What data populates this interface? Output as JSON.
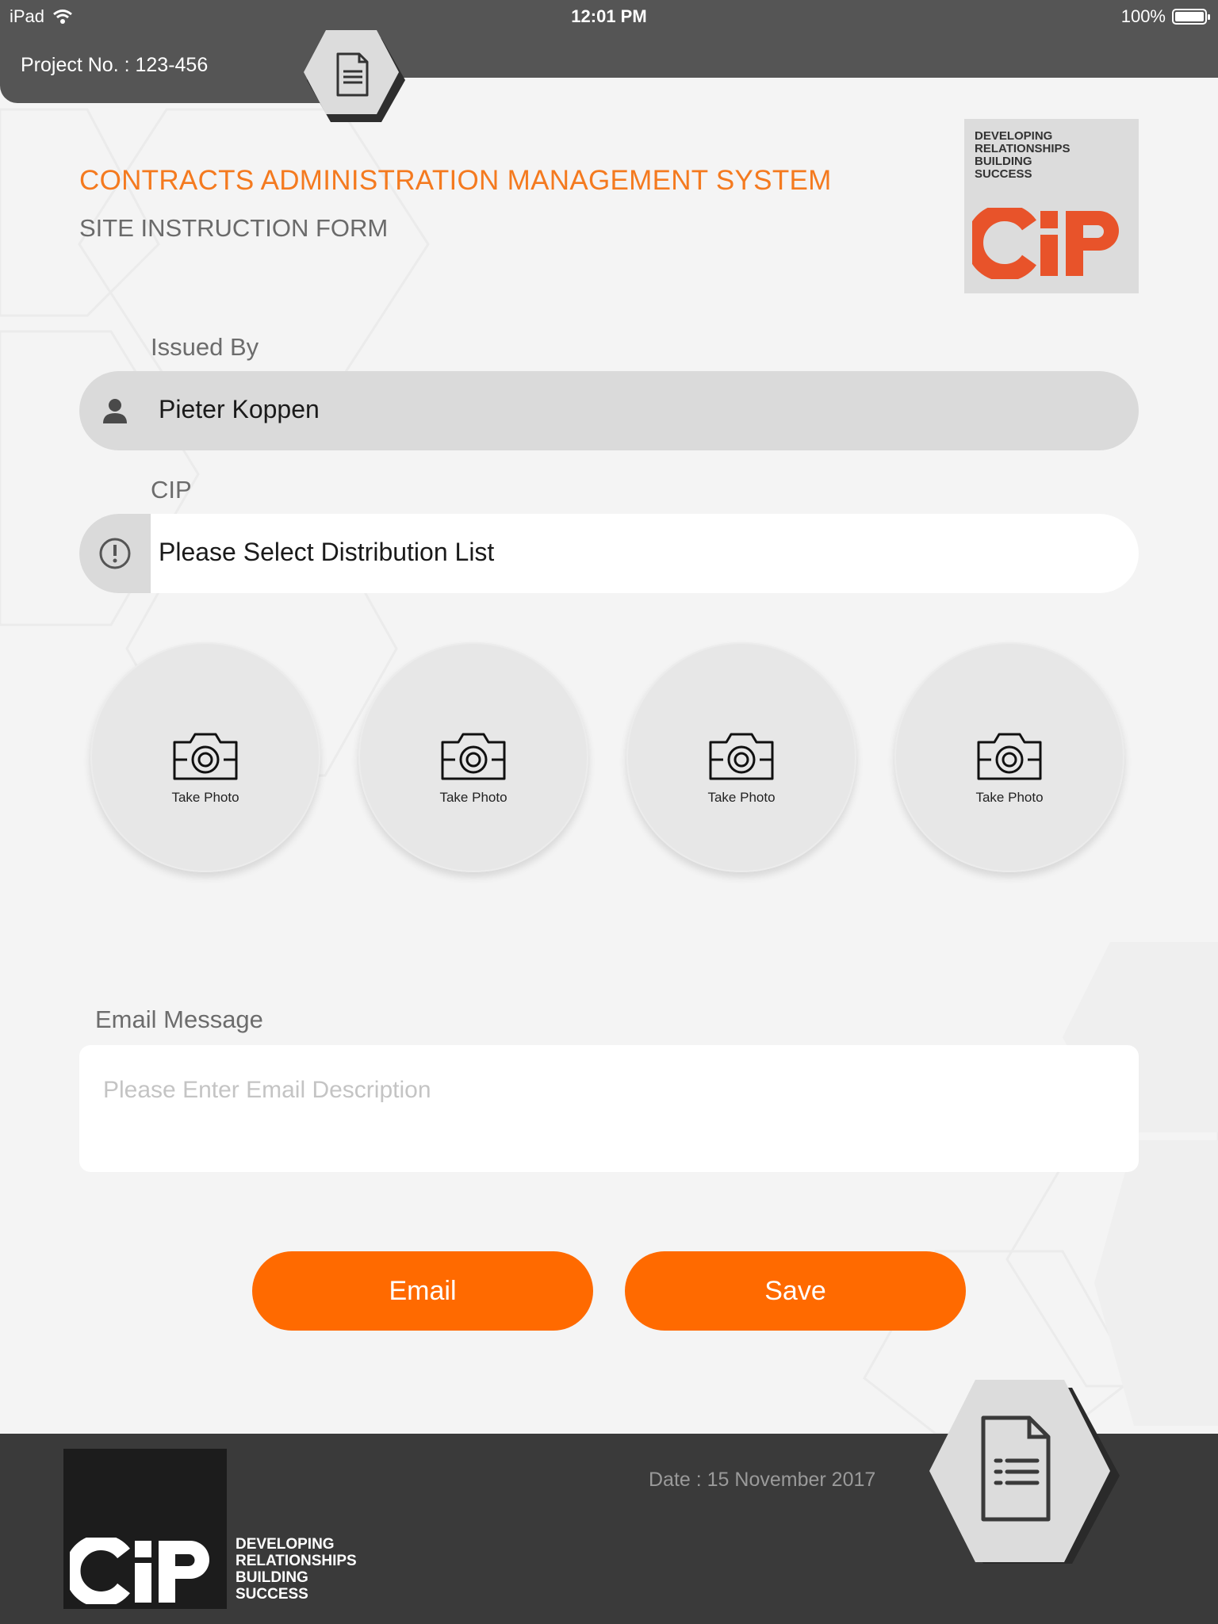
{
  "status_bar": {
    "device": "iPad",
    "time": "12:01 PM",
    "battery": "100%"
  },
  "header": {
    "project_label": "Project No. : 123-456",
    "top_icon": "document-list-icon"
  },
  "titles": {
    "main": "CONTRACTS ADMINISTRATION MANAGEMENT SYSTEM",
    "sub": "SITE INSTRUCTION FORM"
  },
  "logo": {
    "tagline": "DEVELOPING\nRELATIONSHIPS\nBUILDING\nSUCCESS",
    "wordmark": "CIP",
    "color": "#e8532a"
  },
  "form": {
    "issued_by_label": "Issued By",
    "issued_by_value": "Pieter Koppen",
    "issued_by_icon": "person-icon",
    "cip_label": "CIP",
    "cip_value": "Please Select Distribution List",
    "cip_icon": "alert-circle-icon"
  },
  "photos": [
    {
      "label": "Take Photo",
      "icon": "camera-icon"
    },
    {
      "label": "Take Photo",
      "icon": "camera-icon"
    },
    {
      "label": "Take Photo",
      "icon": "camera-icon"
    },
    {
      "label": "Take Photo",
      "icon": "camera-icon"
    }
  ],
  "email": {
    "label": "Email Message",
    "placeholder": "Please Enter Email Description"
  },
  "buttons": {
    "email": "Email",
    "save": "Save"
  },
  "footer": {
    "date": "Date : 15 November 2017",
    "tagline": "DEVELOPING\nRELATIONSHIPS\nBUILDING\nSUCCESS",
    "wordmark": "CIP",
    "icon": "document-list-icon"
  },
  "colors": {
    "accent": "#ff6a00",
    "title": "#f47a1f",
    "bar": "#555555",
    "footer": "#3a3a3a"
  }
}
